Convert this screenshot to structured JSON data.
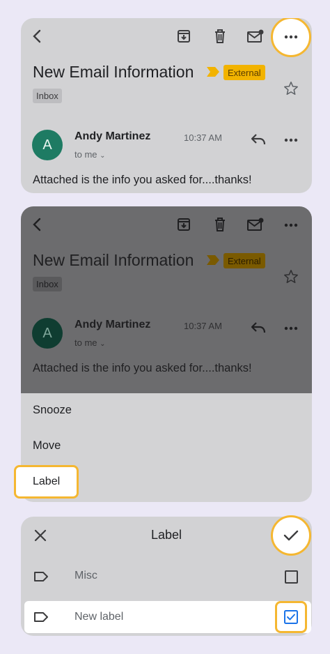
{
  "email": {
    "subject": "New Email Information",
    "external_label": "External",
    "inbox_label": "Inbox",
    "avatar_letter": "A",
    "sender": "Andy Martinez",
    "time": "10:37 AM",
    "to": "to me",
    "snippet": "Attached is the info you asked for....thanks!"
  },
  "menu": {
    "items": [
      "Snooze",
      "Move",
      "Label"
    ]
  },
  "label_dialog": {
    "title": "Label",
    "labels": [
      {
        "name": "Misc",
        "checked": false
      },
      {
        "name": "New label",
        "checked": true
      }
    ]
  },
  "colors": {
    "accent_ring": "#f5b731",
    "external_badge": "#f2b300",
    "avatar": "#1e7b63",
    "checkbox_checked": "#1a73e8"
  }
}
